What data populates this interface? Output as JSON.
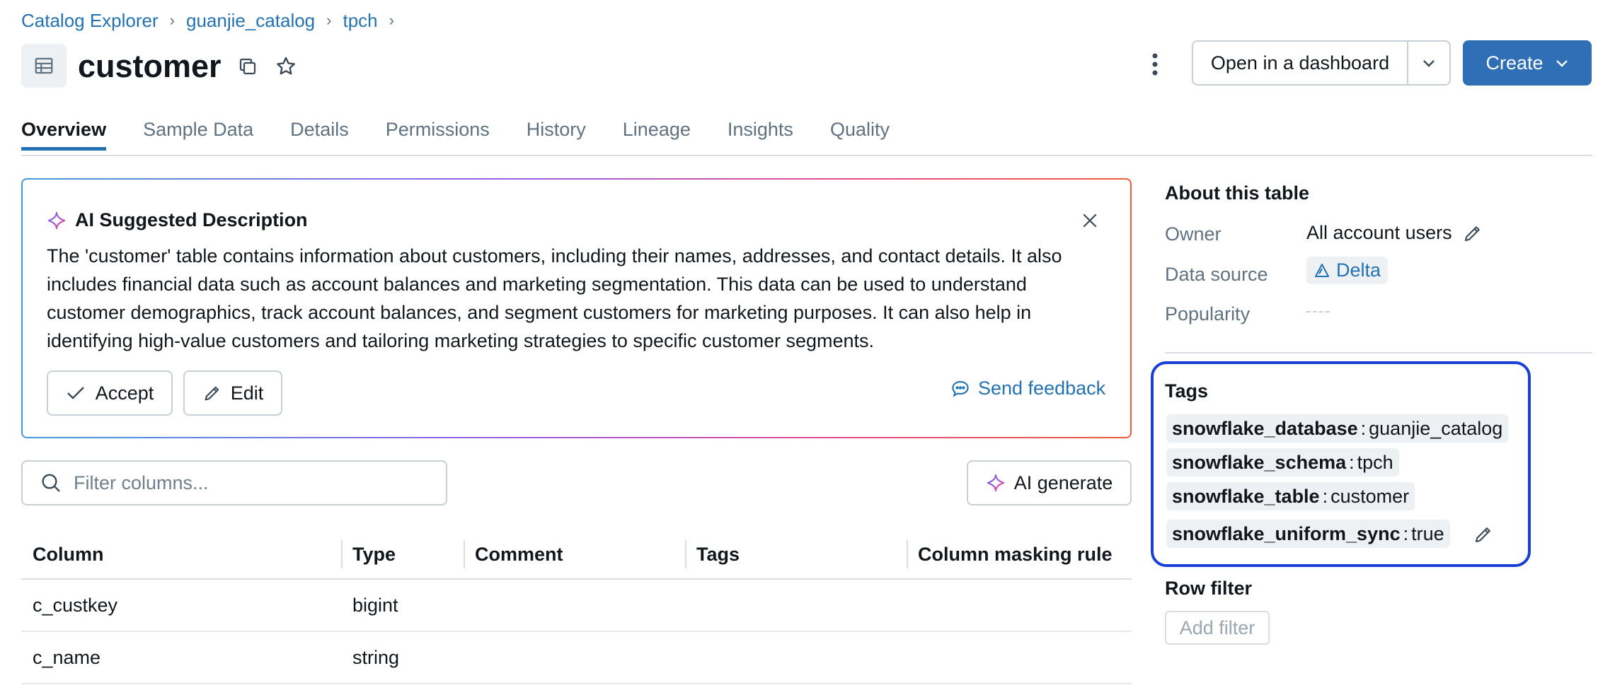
{
  "breadcrumb": [
    "Catalog Explorer",
    "guanjie_catalog",
    "tpch"
  ],
  "header": {
    "title": "customer",
    "open_dashboard_label": "Open in a dashboard",
    "create_label": "Create"
  },
  "tabs": [
    "Overview",
    "Sample Data",
    "Details",
    "Permissions",
    "History",
    "Lineage",
    "Insights",
    "Quality"
  ],
  "ai_suggestion": {
    "title": "AI Suggested Description",
    "text": "The 'customer' table contains information about customers, including their names, addresses, and contact details. It also includes financial data such as account balances and marketing segmentation. This data can be used to understand customer demographics, track account balances, and segment customers for marketing purposes. It can also help in identifying high-value customers and tailoring marketing strategies to specific customer segments.",
    "accept_label": "Accept",
    "edit_label": "Edit",
    "feedback_label": "Send feedback"
  },
  "filter": {
    "placeholder": "Filter columns..."
  },
  "ai_generate_label": "AI generate",
  "columns_table": {
    "headers": [
      "Column",
      "Type",
      "Comment",
      "Tags",
      "Column masking rule"
    ],
    "rows": [
      {
        "name": "c_custkey",
        "type": "bigint"
      },
      {
        "name": "c_name",
        "type": "string"
      }
    ]
  },
  "about": {
    "title": "About this table",
    "owner_label": "Owner",
    "owner_value": "All account users",
    "data_source_label": "Data source",
    "data_source_value": "Delta",
    "popularity_label": "Popularity"
  },
  "tags": {
    "title": "Tags",
    "items": [
      {
        "key": "snowflake_database",
        "value": "guanjie_catalog"
      },
      {
        "key": "snowflake_schema",
        "value": "tpch"
      },
      {
        "key": "snowflake_table",
        "value": "customer"
      },
      {
        "key": "snowflake_uniform_sync",
        "value": "true"
      }
    ]
  },
  "row_filter": {
    "title": "Row filter",
    "add_label": "Add filter"
  },
  "colors": {
    "accent": "#2272b4",
    "primary_button": "#2f6fb6",
    "highlight_border": "#1a3fd6"
  }
}
